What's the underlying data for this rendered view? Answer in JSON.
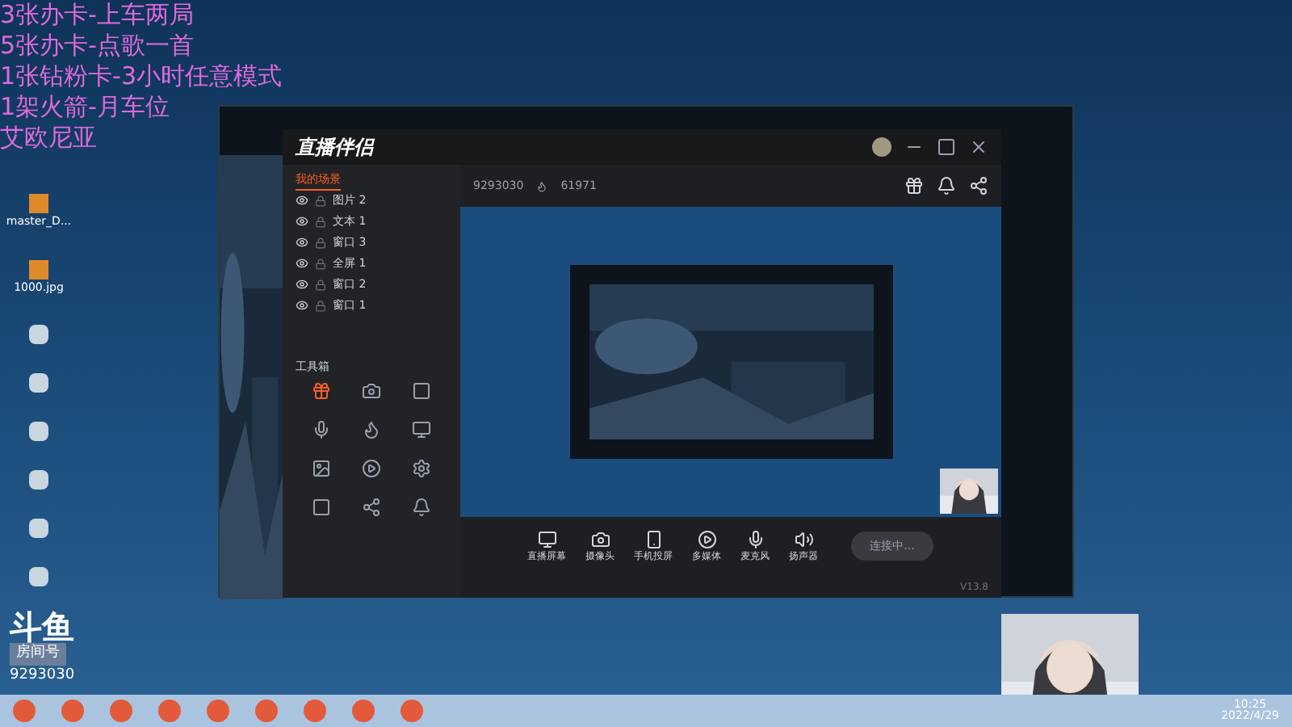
{
  "overlay_lines": [
    "3张办卡-上车两局",
    "5张办卡-点歌一首",
    "1张钻粉卡-3小时任意模式",
    "1架火箭-月车位",
    "艾欧尼亚"
  ],
  "desktop_icons": [
    {
      "label": "master_D..."
    },
    {
      "label": "1000.jpg"
    }
  ],
  "app": {
    "title": "直播伴侣",
    "scene_tabs": [
      {
        "label": "我的场景",
        "selected": true
      }
    ],
    "sources": [
      {
        "label": "图片 2"
      },
      {
        "label": "文本 1"
      },
      {
        "label": "窗口 3"
      },
      {
        "label": "全屏 1"
      },
      {
        "label": "窗口 2"
      },
      {
        "label": "窗口 1"
      }
    ],
    "toolbox_title": "工具箱",
    "room_id": "9293030",
    "popularity": "61971",
    "controls": [
      {
        "label": "直播屏幕"
      },
      {
        "label": "摄像头"
      },
      {
        "label": "手机投屏"
      },
      {
        "label": "多媒体"
      },
      {
        "label": "麦克风"
      },
      {
        "label": "扬声器"
      }
    ],
    "connect_button": "连接中...",
    "version": "V13.8"
  },
  "overlay_logo": {
    "brand": "斗鱼",
    "room_label": "房间号",
    "room_id": "9293030"
  },
  "taskbar": {
    "time": "10:25",
    "date": "2022/4/29"
  }
}
